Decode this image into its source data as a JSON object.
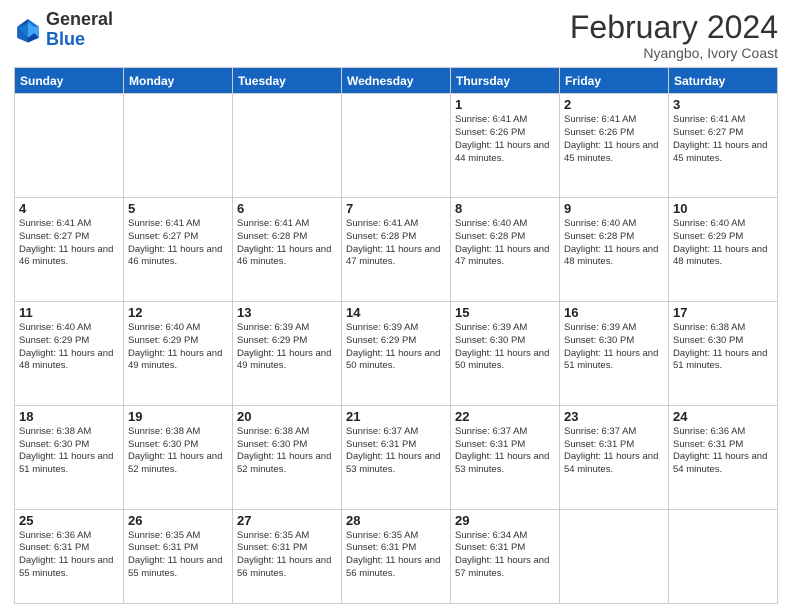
{
  "header": {
    "logo_general": "General",
    "logo_blue": "Blue",
    "month_title": "February 2024",
    "location": "Nyangbo, Ivory Coast"
  },
  "days_of_week": [
    "Sunday",
    "Monday",
    "Tuesday",
    "Wednesday",
    "Thursday",
    "Friday",
    "Saturday"
  ],
  "weeks": [
    [
      {
        "day": "",
        "info": ""
      },
      {
        "day": "",
        "info": ""
      },
      {
        "day": "",
        "info": ""
      },
      {
        "day": "",
        "info": ""
      },
      {
        "day": "1",
        "info": "Sunrise: 6:41 AM\nSunset: 6:26 PM\nDaylight: 11 hours and 44 minutes."
      },
      {
        "day": "2",
        "info": "Sunrise: 6:41 AM\nSunset: 6:26 PM\nDaylight: 11 hours and 45 minutes."
      },
      {
        "day": "3",
        "info": "Sunrise: 6:41 AM\nSunset: 6:27 PM\nDaylight: 11 hours and 45 minutes."
      }
    ],
    [
      {
        "day": "4",
        "info": "Sunrise: 6:41 AM\nSunset: 6:27 PM\nDaylight: 11 hours and 46 minutes."
      },
      {
        "day": "5",
        "info": "Sunrise: 6:41 AM\nSunset: 6:27 PM\nDaylight: 11 hours and 46 minutes."
      },
      {
        "day": "6",
        "info": "Sunrise: 6:41 AM\nSunset: 6:28 PM\nDaylight: 11 hours and 46 minutes."
      },
      {
        "day": "7",
        "info": "Sunrise: 6:41 AM\nSunset: 6:28 PM\nDaylight: 11 hours and 47 minutes."
      },
      {
        "day": "8",
        "info": "Sunrise: 6:40 AM\nSunset: 6:28 PM\nDaylight: 11 hours and 47 minutes."
      },
      {
        "day": "9",
        "info": "Sunrise: 6:40 AM\nSunset: 6:28 PM\nDaylight: 11 hours and 48 minutes."
      },
      {
        "day": "10",
        "info": "Sunrise: 6:40 AM\nSunset: 6:29 PM\nDaylight: 11 hours and 48 minutes."
      }
    ],
    [
      {
        "day": "11",
        "info": "Sunrise: 6:40 AM\nSunset: 6:29 PM\nDaylight: 11 hours and 48 minutes."
      },
      {
        "day": "12",
        "info": "Sunrise: 6:40 AM\nSunset: 6:29 PM\nDaylight: 11 hours and 49 minutes."
      },
      {
        "day": "13",
        "info": "Sunrise: 6:39 AM\nSunset: 6:29 PM\nDaylight: 11 hours and 49 minutes."
      },
      {
        "day": "14",
        "info": "Sunrise: 6:39 AM\nSunset: 6:29 PM\nDaylight: 11 hours and 50 minutes."
      },
      {
        "day": "15",
        "info": "Sunrise: 6:39 AM\nSunset: 6:30 PM\nDaylight: 11 hours and 50 minutes."
      },
      {
        "day": "16",
        "info": "Sunrise: 6:39 AM\nSunset: 6:30 PM\nDaylight: 11 hours and 51 minutes."
      },
      {
        "day": "17",
        "info": "Sunrise: 6:38 AM\nSunset: 6:30 PM\nDaylight: 11 hours and 51 minutes."
      }
    ],
    [
      {
        "day": "18",
        "info": "Sunrise: 6:38 AM\nSunset: 6:30 PM\nDaylight: 11 hours and 51 minutes."
      },
      {
        "day": "19",
        "info": "Sunrise: 6:38 AM\nSunset: 6:30 PM\nDaylight: 11 hours and 52 minutes."
      },
      {
        "day": "20",
        "info": "Sunrise: 6:38 AM\nSunset: 6:30 PM\nDaylight: 11 hours and 52 minutes."
      },
      {
        "day": "21",
        "info": "Sunrise: 6:37 AM\nSunset: 6:31 PM\nDaylight: 11 hours and 53 minutes."
      },
      {
        "day": "22",
        "info": "Sunrise: 6:37 AM\nSunset: 6:31 PM\nDaylight: 11 hours and 53 minutes."
      },
      {
        "day": "23",
        "info": "Sunrise: 6:37 AM\nSunset: 6:31 PM\nDaylight: 11 hours and 54 minutes."
      },
      {
        "day": "24",
        "info": "Sunrise: 6:36 AM\nSunset: 6:31 PM\nDaylight: 11 hours and 54 minutes."
      }
    ],
    [
      {
        "day": "25",
        "info": "Sunrise: 6:36 AM\nSunset: 6:31 PM\nDaylight: 11 hours and 55 minutes."
      },
      {
        "day": "26",
        "info": "Sunrise: 6:35 AM\nSunset: 6:31 PM\nDaylight: 11 hours and 55 minutes."
      },
      {
        "day": "27",
        "info": "Sunrise: 6:35 AM\nSunset: 6:31 PM\nDaylight: 11 hours and 56 minutes."
      },
      {
        "day": "28",
        "info": "Sunrise: 6:35 AM\nSunset: 6:31 PM\nDaylight: 11 hours and 56 minutes."
      },
      {
        "day": "29",
        "info": "Sunrise: 6:34 AM\nSunset: 6:31 PM\nDaylight: 11 hours and 57 minutes."
      },
      {
        "day": "",
        "info": ""
      },
      {
        "day": "",
        "info": ""
      }
    ]
  ]
}
